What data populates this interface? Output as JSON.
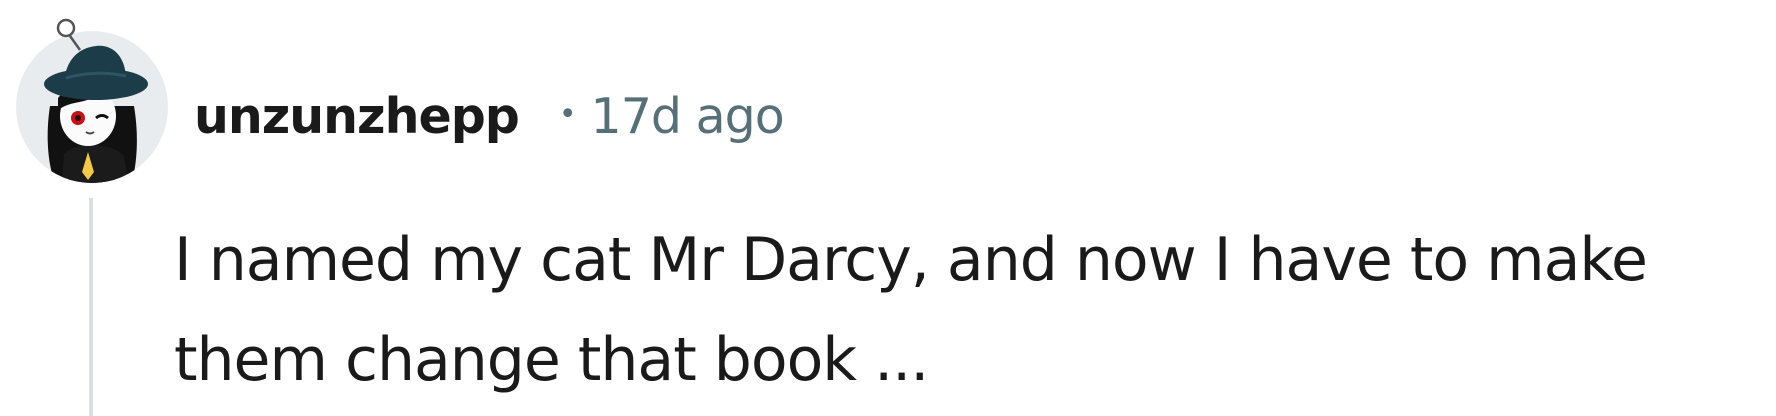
{
  "comment": {
    "author": "unzunzhepp",
    "separator": "•",
    "age": "17d ago",
    "body_lines": [
      "I named my cat Mr Darcy, and now I have to make",
      "them change that book ..."
    ]
  },
  "colors": {
    "text": "#1a1a1b",
    "meta": "#576f76",
    "thread_line": "#dcdfe2",
    "avatar_bg": "#e9ecee",
    "hat": "#1d3c4a"
  },
  "icons": {
    "avatar": "user-avatar-witch-hat"
  }
}
